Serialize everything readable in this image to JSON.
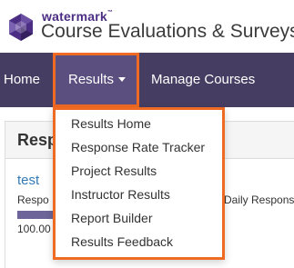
{
  "brand": {
    "company": "watermark",
    "trademark": "™",
    "product": "Course Evaluations & Surveys",
    "logo_color": "#4b2e83"
  },
  "nav": {
    "home": "Home",
    "results": "Results",
    "manage_courses": "Manage Courses",
    "bar_color": "#463d63",
    "highlight_color": "#ef6a22"
  },
  "dropdown": {
    "items": [
      "Results Home",
      "Response Rate Tracker",
      "Project Results",
      "Instructor Results",
      "Report Builder",
      "Results Feedback"
    ]
  },
  "panel": {
    "title": "Resp",
    "project_link": "test",
    "response_label": "Respo",
    "response_rate": "100.00",
    "daily_label": "Daily Respons"
  }
}
